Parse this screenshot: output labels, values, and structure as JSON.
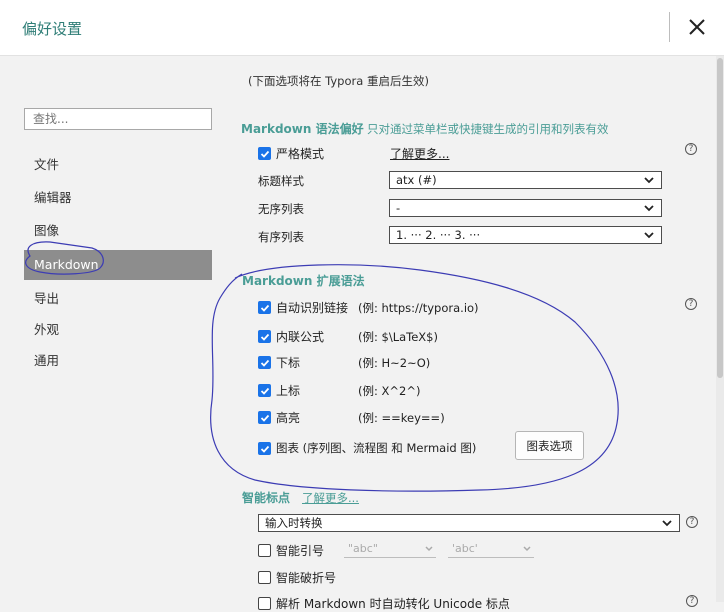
{
  "window": {
    "title": "偏好设置"
  },
  "sidebar": {
    "search_placeholder": "查找...",
    "items": [
      {
        "label": "文件"
      },
      {
        "label": "编辑器"
      },
      {
        "label": "图像"
      },
      {
        "label": "Markdown"
      },
      {
        "label": "导出"
      },
      {
        "label": "外观"
      },
      {
        "label": "通用"
      }
    ],
    "active": "Markdown"
  },
  "main": {
    "restart_note": "(下面选项将在 Typora 重启后生效)",
    "syntax_pref": {
      "title": "Markdown 语法偏好",
      "subtitle": "只对通过菜单栏或快捷键生成的引用和列表有效",
      "strict_mode": {
        "label": "严格模式",
        "checked": true,
        "learn_more": "了解更多..."
      },
      "heading_style": {
        "label": "标题样式",
        "value": "atx (#)"
      },
      "unordered_list": {
        "label": "无序列表",
        "value": "-"
      },
      "ordered_list": {
        "label": "有序列表",
        "value": "1. ··· 2. ··· 3. ···"
      }
    },
    "extended_syntax": {
      "title": "Markdown 扩展语法",
      "items": [
        {
          "label": "自动识别链接",
          "example": "(例: https://typora.io)",
          "checked": true
        },
        {
          "label": "内联公式",
          "example": "(例:  $\\LaTeX$)",
          "checked": true
        },
        {
          "label": "下标",
          "example": "(例:  H~2~O)",
          "checked": true
        },
        {
          "label": "上标",
          "example": "(例:  X^2^)",
          "checked": true
        },
        {
          "label": "高亮",
          "example": "(例:  ==key==)",
          "checked": true
        },
        {
          "label": "图表 (序列图、流程图 和 Mermaid 图)",
          "example": "",
          "checked": true
        }
      ],
      "chart_options_button": "图表选项"
    },
    "smart_punct": {
      "title": "智能标点",
      "learn_more": "了解更多...",
      "mode": "输入时转换",
      "smart_quotes": {
        "label": "智能引号",
        "checked": false,
        "double": "\"abc\"",
        "single": "'abc'"
      },
      "smart_dash": {
        "label": "智能破折号",
        "checked": false
      },
      "cut_off": "解析 Markdown 时自动转化 Unicode 标点"
    }
  },
  "colors": {
    "accent": "#4a9d96",
    "checkbox": "#1a73e8",
    "active_item": "#8d8d8d",
    "annotation": "#3c3cb4"
  }
}
